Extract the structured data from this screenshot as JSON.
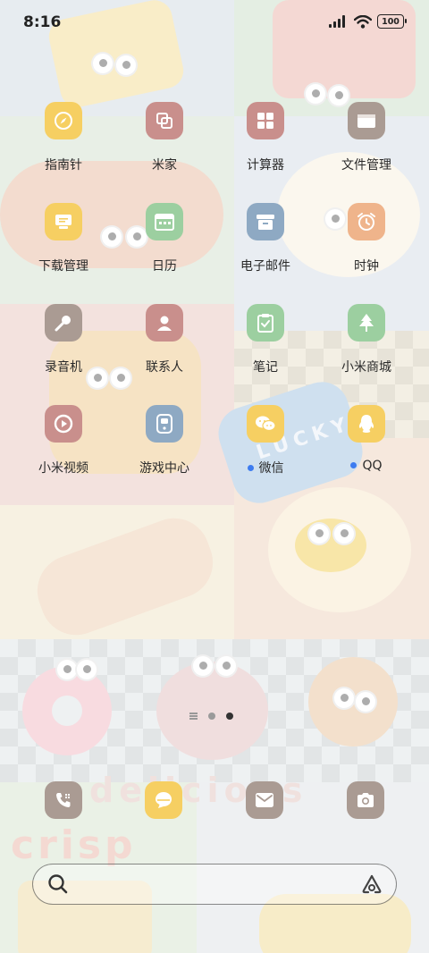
{
  "status_bar": {
    "time": "8:16",
    "battery": "100",
    "icons": [
      "signal-icon",
      "wifi-icon",
      "battery-icon"
    ]
  },
  "apps": [
    {
      "name": "指南针",
      "icon": "compass-icon",
      "color": "#f6cf62"
    },
    {
      "name": "米家",
      "icon": "mijia-icon",
      "color": "#c98f8c"
    },
    {
      "name": "计算器",
      "icon": "calculator-icon",
      "color": "#c98f8c"
    },
    {
      "name": "文件管理",
      "icon": "folder-icon",
      "color": "#aa9b93"
    },
    {
      "name": "下载管理",
      "icon": "download-icon",
      "color": "#f6cf62"
    },
    {
      "name": "日历",
      "icon": "calendar-icon",
      "color": "#9ccfa0"
    },
    {
      "name": "电子邮件",
      "icon": "mailbox-icon",
      "color": "#8ea9c3"
    },
    {
      "name": "时钟",
      "icon": "alarm-clock-icon",
      "color": "#efb48b"
    },
    {
      "name": "录音机",
      "icon": "microphone-icon",
      "color": "#aa9b93"
    },
    {
      "name": "联系人",
      "icon": "contact-icon",
      "color": "#c98f8c"
    },
    {
      "name": "笔记",
      "icon": "notes-icon",
      "color": "#9ccfa0"
    },
    {
      "name": "小米商城",
      "icon": "tree-icon",
      "color": "#9ccfa0"
    },
    {
      "name": "小米视频",
      "icon": "play-icon",
      "color": "#c98f8c"
    },
    {
      "name": "游戏中心",
      "icon": "gamepad-icon",
      "color": "#8ea9c3"
    },
    {
      "name": "微信",
      "icon": "wechat-icon",
      "color": "#f6cf62",
      "new_badge": true
    },
    {
      "name": "QQ",
      "icon": "qq-penguin-icon",
      "color": "#f6cf62",
      "new_badge": true
    }
  ],
  "page_indicator": {
    "pages": 2,
    "active": 2
  },
  "dock": [
    {
      "icon": "phone-icon",
      "color": "#aa9b93"
    },
    {
      "icon": "chat-bubble-icon",
      "color": "#f6cf62"
    },
    {
      "icon": "mail-icon",
      "color": "#aa9b93"
    },
    {
      "icon": "camera-icon",
      "color": "#aa9b93"
    }
  ],
  "search_bar": {
    "left_icon": "search-icon",
    "right_icon": "assistant-icon"
  },
  "wallpaper": {
    "words": [
      "LUCKY",
      "delicious",
      "crisp"
    ]
  }
}
